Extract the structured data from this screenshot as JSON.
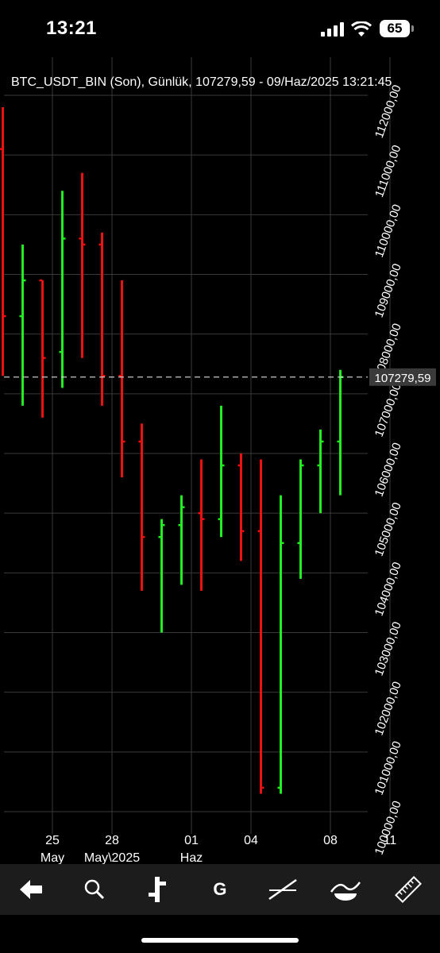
{
  "status_bar": {
    "time": "13:21",
    "battery": "65"
  },
  "chart_header": {
    "title": "BTC_USDT_BIN (Son), Günlük, 107279,59 - 09/Haz/2025 13:21:45"
  },
  "colors": {
    "up": "#22ee22",
    "down": "#ee1111",
    "grid": "#3a3a3a",
    "background": "#000000"
  },
  "toolbar": {
    "items": [
      {
        "name": "back-arrow-icon"
      },
      {
        "name": "search-icon"
      },
      {
        "name": "bar-style-icon"
      },
      {
        "name": "g-icon",
        "label": "G"
      },
      {
        "name": "trendline-icon"
      },
      {
        "name": "indicator-icon"
      },
      {
        "name": "ruler-icon"
      }
    ]
  },
  "chart_data": {
    "type": "ohlc",
    "title": "BTC_USDT_BIN (Son), Günlük, 107279,59 - 09/Haz/2025 13:21:45",
    "last_price": 107279.59,
    "last_price_label": "107279,59",
    "y_range": [
      99700,
      112000
    ],
    "y_ticks": [
      100000,
      101000,
      102000,
      103000,
      104000,
      105000,
      106000,
      107000,
      108000,
      109000,
      110000,
      111000,
      112000
    ],
    "y_tick_labels": [
      "100000,00",
      "101000,00",
      "102000,00",
      "103000,00",
      "104000,00",
      "105000,00",
      "106000,00",
      "107000,00",
      "108000,00",
      "109000,00",
      "110000,00",
      "111000,00",
      "112000,00"
    ],
    "x_ticks": [
      {
        "label": "25",
        "sub": "May",
        "day": 25
      },
      {
        "label": "28",
        "sub": "May\\2025",
        "day": 28
      },
      {
        "label": "01",
        "sub": "Haz",
        "day": 32
      },
      {
        "label": "04",
        "sub": "",
        "day": 35
      },
      {
        "label": "08",
        "sub": "",
        "day": 39
      },
      {
        "label": "11",
        "sub": "",
        "day": 42
      }
    ],
    "bars": [
      {
        "day": 22.5,
        "open": 111100,
        "high": 111800,
        "low": 107300,
        "close": 108300
      },
      {
        "day": 23.5,
        "open": 108300,
        "high": 109500,
        "low": 106800,
        "close": 108900
      },
      {
        "day": 24.5,
        "open": 108900,
        "high": 108900,
        "low": 106600,
        "close": 107600
      },
      {
        "day": 25.5,
        "open": 107700,
        "high": 110400,
        "low": 107100,
        "close": 109600
      },
      {
        "day": 26.5,
        "open": 109600,
        "high": 110700,
        "low": 107600,
        "close": 109500
      },
      {
        "day": 27.5,
        "open": 109500,
        "high": 109700,
        "low": 106800,
        "close": 107300
      },
      {
        "day": 28.5,
        "open": 107300,
        "high": 108900,
        "low": 105600,
        "close": 106200
      },
      {
        "day": 29.5,
        "open": 106200,
        "high": 106500,
        "low": 103700,
        "close": 104600
      },
      {
        "day": 30.5,
        "open": 104600,
        "high": 104900,
        "low": 103000,
        "close": 104800
      },
      {
        "day": 31.5,
        "open": 104800,
        "high": 105300,
        "low": 103800,
        "close": 105100
      },
      {
        "day": 32.5,
        "open": 105000,
        "high": 105900,
        "low": 103700,
        "close": 104900
      },
      {
        "day": 33.5,
        "open": 104900,
        "high": 106800,
        "low": 104600,
        "close": 105800
      },
      {
        "day": 34.5,
        "open": 105800,
        "high": 106000,
        "low": 104200,
        "close": 104700
      },
      {
        "day": 35.5,
        "open": 104700,
        "high": 105900,
        "low": 100300,
        "close": 100400
      },
      {
        "day": 36.5,
        "open": 100400,
        "high": 105300,
        "low": 100300,
        "close": 104500
      },
      {
        "day": 37.5,
        "open": 104500,
        "high": 105900,
        "low": 103900,
        "close": 105800
      },
      {
        "day": 38.5,
        "open": 105800,
        "high": 106400,
        "low": 105000,
        "close": 106200
      },
      {
        "day": 39.5,
        "open": 106200,
        "high": 107400,
        "low": 105300,
        "close": 107280
      }
    ]
  }
}
